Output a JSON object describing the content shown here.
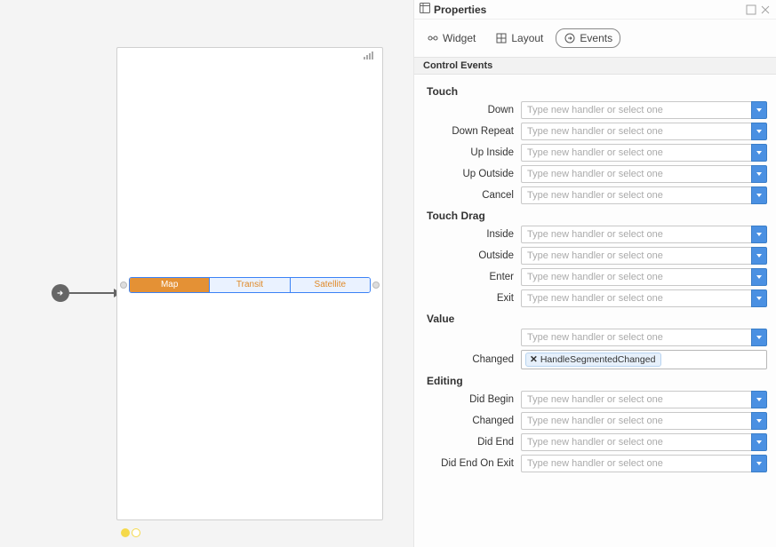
{
  "panel": {
    "title": "Properties"
  },
  "tabs": {
    "widget": "Widget",
    "layout": "Layout",
    "events": "Events"
  },
  "sectionHeader": "Control Events",
  "groups": {
    "touch": {
      "label": "Touch",
      "rows": {
        "down": "Down",
        "downRepeat": "Down Repeat",
        "upInside": "Up Inside",
        "upOutside": "Up Outside",
        "cancel": "Cancel"
      }
    },
    "touchDrag": {
      "label": "Touch Drag",
      "rows": {
        "inside": "Inside",
        "outside": "Outside",
        "enter": "Enter",
        "exit": "Exit"
      }
    },
    "value": {
      "label": "Value",
      "rows": {
        "emptyAbove": "(value)",
        "changed": "Changed"
      },
      "changedTag": "HandleSegmentedChanged"
    },
    "editing": {
      "label": "Editing",
      "rows": {
        "didBegin": "Did Begin",
        "changed": "Changed",
        "didEnd": "Did End",
        "didEndOnExit": "Did End On Exit"
      }
    }
  },
  "placeholder": "Type new handler or select one",
  "device": {
    "carrier": "",
    "segments": {
      "map": "Map",
      "transit": "Transit",
      "satellite": "Satellite"
    }
  }
}
